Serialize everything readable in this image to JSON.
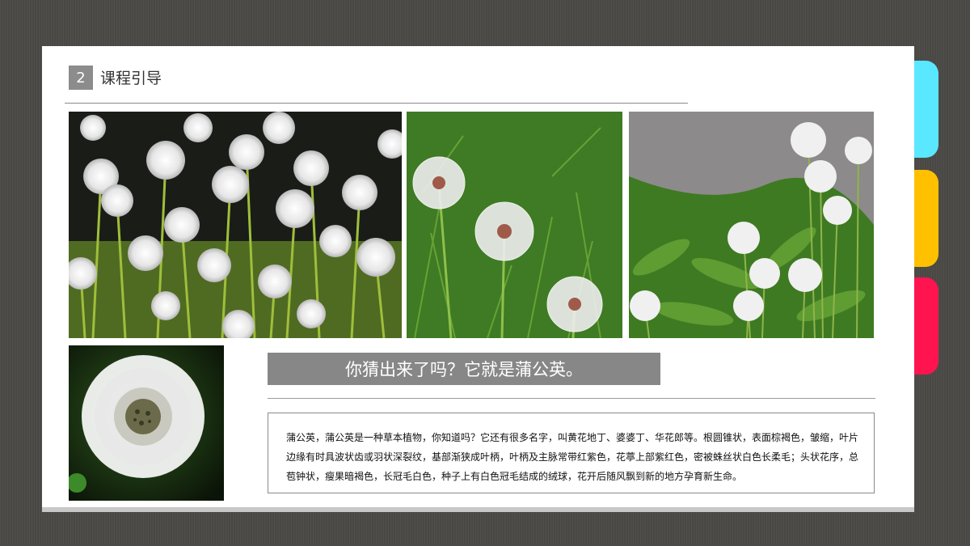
{
  "section": {
    "number": "2",
    "title": "课程引导"
  },
  "banner": {
    "text": "你猜出来了吗？它就是蒲公英。"
  },
  "description": {
    "text": "蒲公英，蒲公英是一种草本植物，你知道吗？它还有很多名字，叫黄花地丁、婆婆丁、华花郎等。根圆锥状，表面棕褐色，皱缩，叶片边缘有时具波状齿或羽状深裂纹，基部渐狭成叶柄，叶柄及主脉常带红紫色，花葶上部紫红色，密被蛛丝状白色长柔毛；头状花序，总苞钟状，瘦果暗褐色，长冠毛白色，种子上有白色冠毛结成的绒球，花开后随风飘到新的地方孕育新生命。"
  },
  "colors": {
    "background": "#4a4844",
    "tab_cyan": "#59e8ff",
    "tab_yellow": "#ffc000",
    "tab_red": "#ff1450",
    "banner": "#878787"
  },
  "images": [
    "dandelion-field-photo",
    "dandelion-grass-photo",
    "dandelion-roadside-photo",
    "dandelion-closeup-photo"
  ]
}
